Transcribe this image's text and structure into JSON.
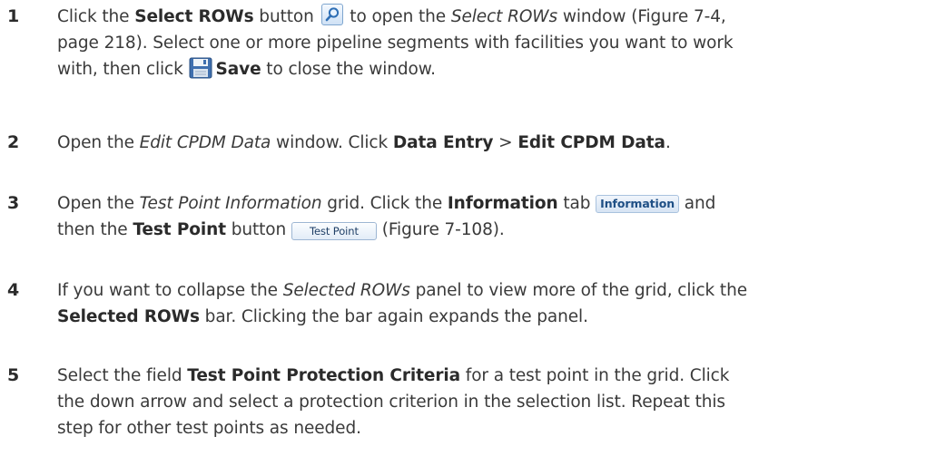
{
  "steps": [
    {
      "num": "1",
      "parts": {
        "a1": "Click the ",
        "b1": "Select ROWs",
        "a2": " button ",
        "a3": " to open the ",
        "i1": "Select ROWs",
        "a4": " window (Figure 7-4,",
        "l2": "page 218). Select one or more pipeline segments with facilities you want to work",
        "a5": "with, then click ",
        "b2": "Save",
        "a6": " to close the window."
      },
      "icons": {
        "select_button": "magnifier-icon",
        "save": "floppy-disk-icon"
      }
    },
    {
      "num": "2",
      "parts": {
        "a1": "Open the ",
        "i1": "Edit CPDM Data",
        "a2": " window. Click ",
        "b1": "Data Entry",
        "a3": " > ",
        "b2": "Edit CPDM Data",
        "a4": "."
      }
    },
    {
      "num": "3",
      "parts": {
        "a1": "Open the ",
        "i1": "Test Point Information",
        "a2": " grid. Click the ",
        "b1": "Information",
        "a3": " tab ",
        "tab_label": "Information",
        "a4": " and",
        "a5": "then the ",
        "b2": "Test Point",
        "a6": " button ",
        "button_label": "Test Point",
        "a7": " (Figure 7-108)."
      }
    },
    {
      "num": "4",
      "parts": {
        "a1": "If you want to collapse the ",
        "i1": "Selected ROWs",
        "a2": " panel to view more of the grid, click the",
        "b1": "Selected ROWs",
        "a3": " bar. Clicking the bar again expands the panel."
      }
    },
    {
      "num": "5",
      "parts": {
        "a1": "Select the field ",
        "b1": "Test Point Protection Criteria",
        "a2": " for a test point in the grid. Click",
        "l2": "the down arrow and select a protection criterion in the selection list. Repeat this",
        "l3": "step for other test points as needed."
      }
    }
  ]
}
